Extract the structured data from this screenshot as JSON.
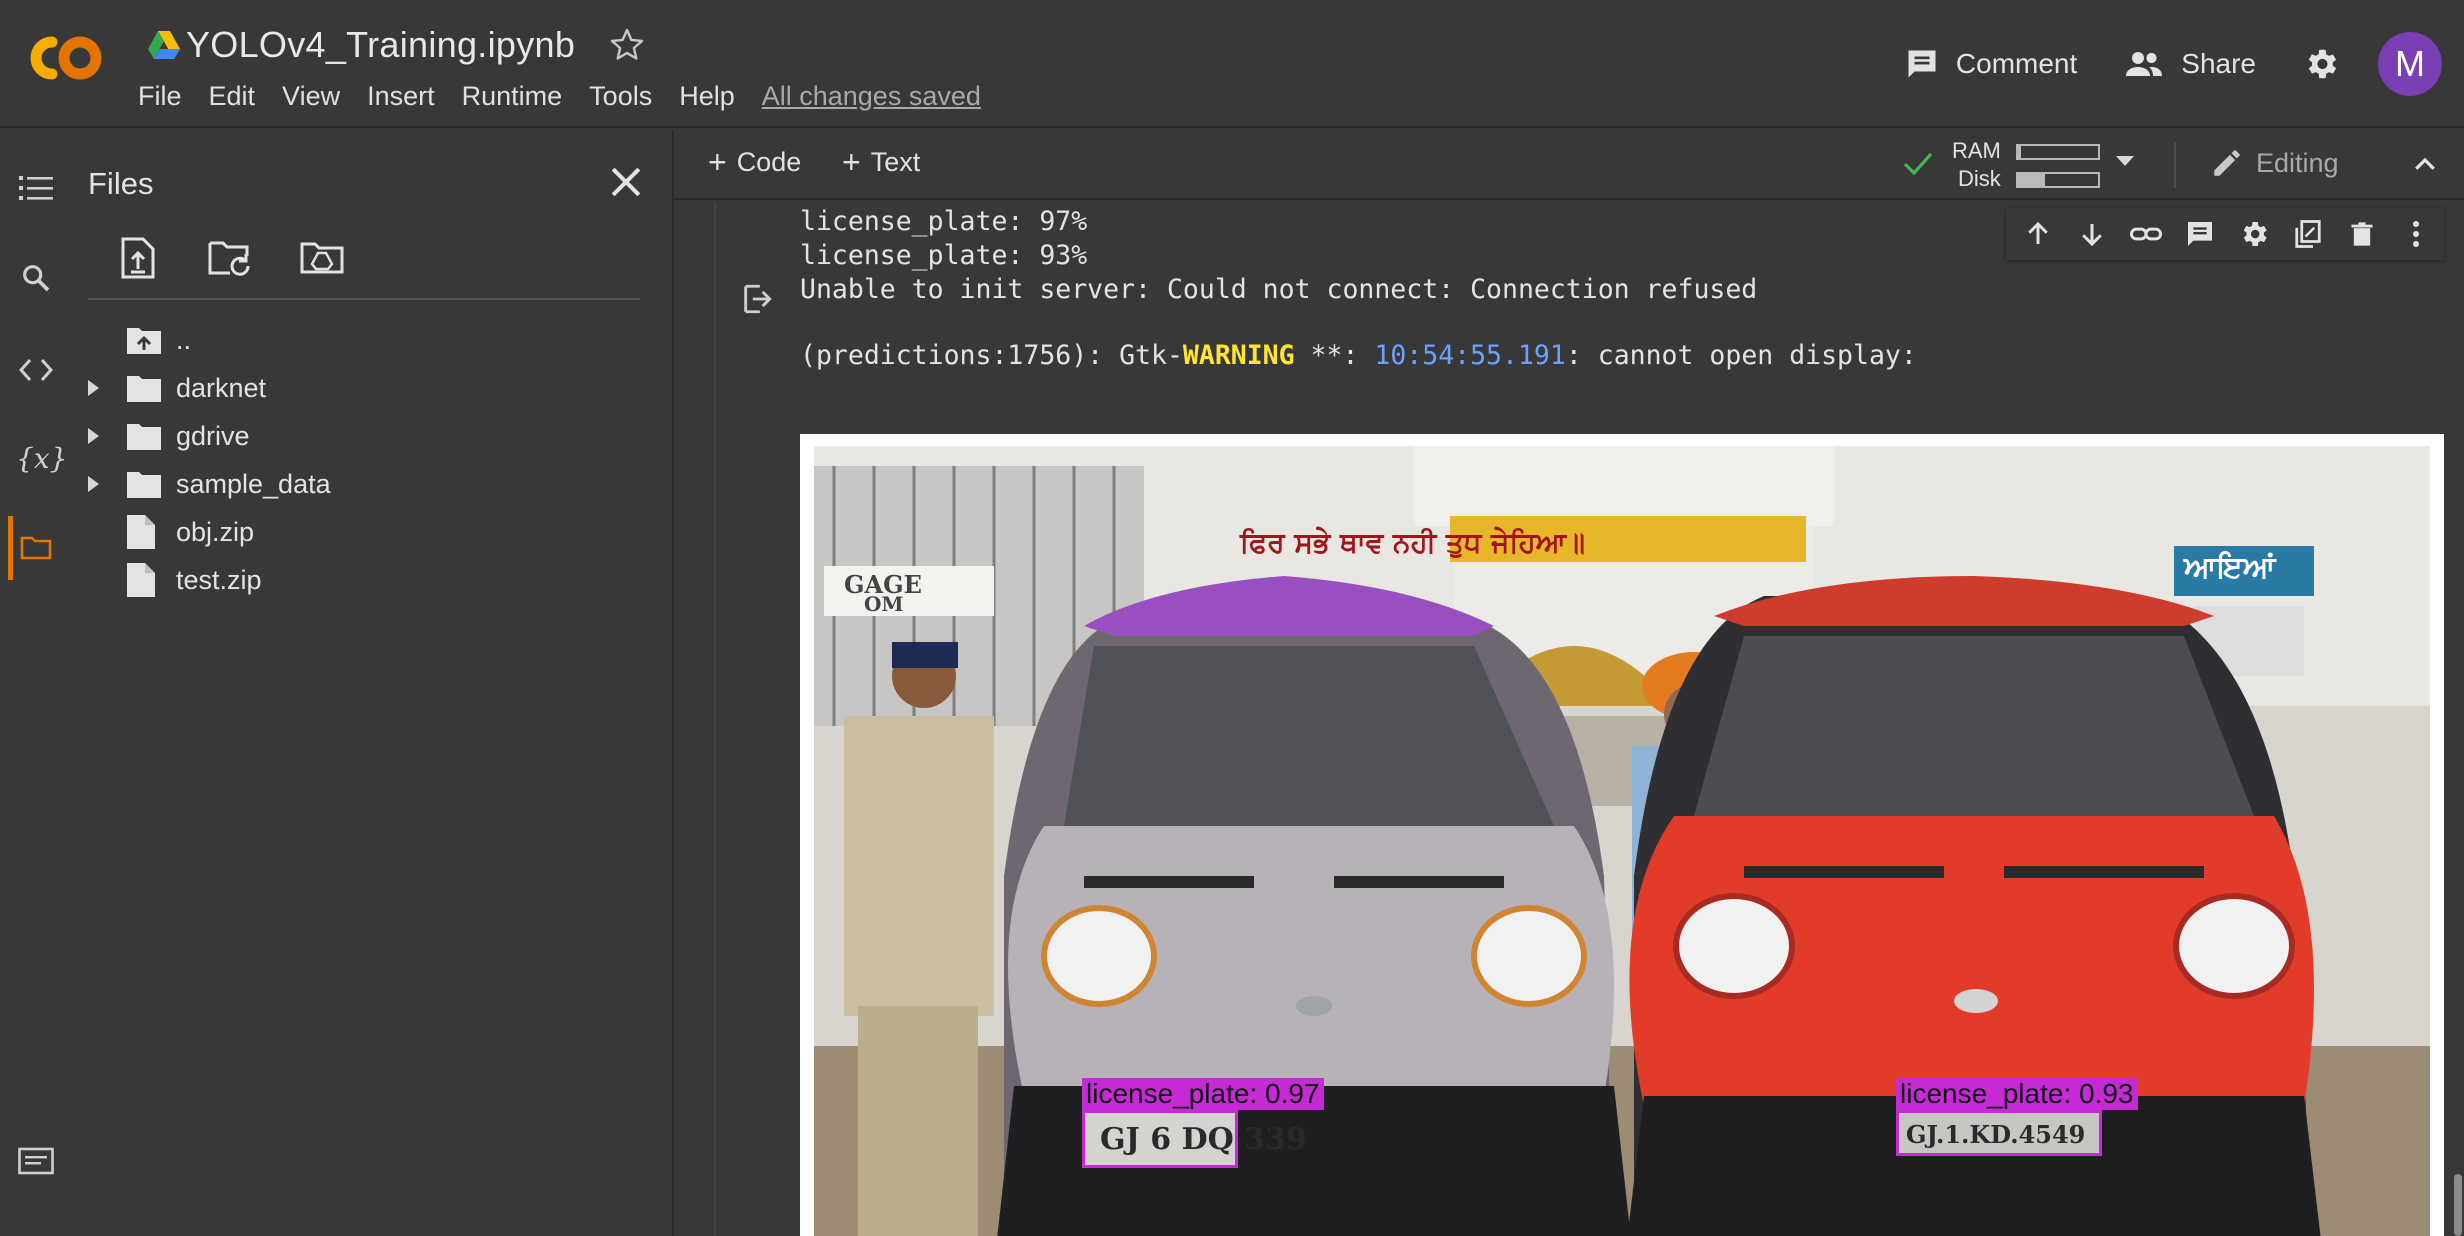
{
  "app": {
    "document_title": "YOLOv4_Training.ipynb",
    "menu": [
      "File",
      "Edit",
      "View",
      "Insert",
      "Runtime",
      "Tools",
      "Help"
    ],
    "save_status": "All changes saved",
    "comment_label": "Comment",
    "share_label": "Share",
    "avatar_initial": "M"
  },
  "files_panel": {
    "title": "Files",
    "tree": [
      {
        "name": "..",
        "type": "parent"
      },
      {
        "name": "darknet",
        "type": "folder"
      },
      {
        "name": "gdrive",
        "type": "folder"
      },
      {
        "name": "sample_data",
        "type": "folder"
      },
      {
        "name": "obj.zip",
        "type": "file"
      },
      {
        "name": "test.zip",
        "type": "file"
      }
    ]
  },
  "toolbar": {
    "add_code": "Code",
    "add_text": "Text",
    "ram_label": "RAM",
    "disk_label": "Disk",
    "ram_usage": 0.04,
    "disk_usage": 0.34,
    "mode_label": "Editing"
  },
  "output": {
    "lines": [
      "license_plate: 97%",
      "license_plate: 93%",
      "Unable to init server: Could not connect: Connection refused"
    ],
    "gtk_prefix": "(predictions:1756): Gtk-",
    "gtk_level": "WARNING",
    "gtk_mid": " **: ",
    "gtk_timestamp": "10:54:55.191",
    "gtk_suffix": ": cannot open display:"
  },
  "image": {
    "detections": [
      {
        "label": "license_plate: 0.97",
        "plate_text": "GJ 6 DQ 339"
      },
      {
        "label": "license_plate: 0.93",
        "plate_text": "GJ.1.KD.4549"
      }
    ],
    "sign_text": "ਫਿਰ ਸਭੇ ਥਾਵ ਨਹੀ ਤੁਧ ਜੇਹਿਆ॥",
    "right_sign_text": "ਆਇਆਂ",
    "gate_sign": "GAGE",
    "gate_sign2": "OM"
  },
  "colors": {
    "accent": "#e37400",
    "detection": "#c52ad6",
    "warning": "#ffe433",
    "timestamp": "#6ba2ff",
    "avatar": "#7b3fb5"
  },
  "icons": {
    "rail": [
      "toc-icon",
      "search-icon",
      "code-snippets-icon",
      "variables-icon",
      "folder-icon",
      "terminal-icon"
    ],
    "files_toolbar": [
      "upload-file-icon",
      "refresh-folder-icon",
      "mount-drive-icon"
    ],
    "cell_toolbar": [
      "move-up-icon",
      "move-down-icon",
      "link-icon",
      "comment-icon",
      "settings-icon",
      "mirror-cell-icon",
      "delete-icon",
      "more-icon"
    ]
  }
}
